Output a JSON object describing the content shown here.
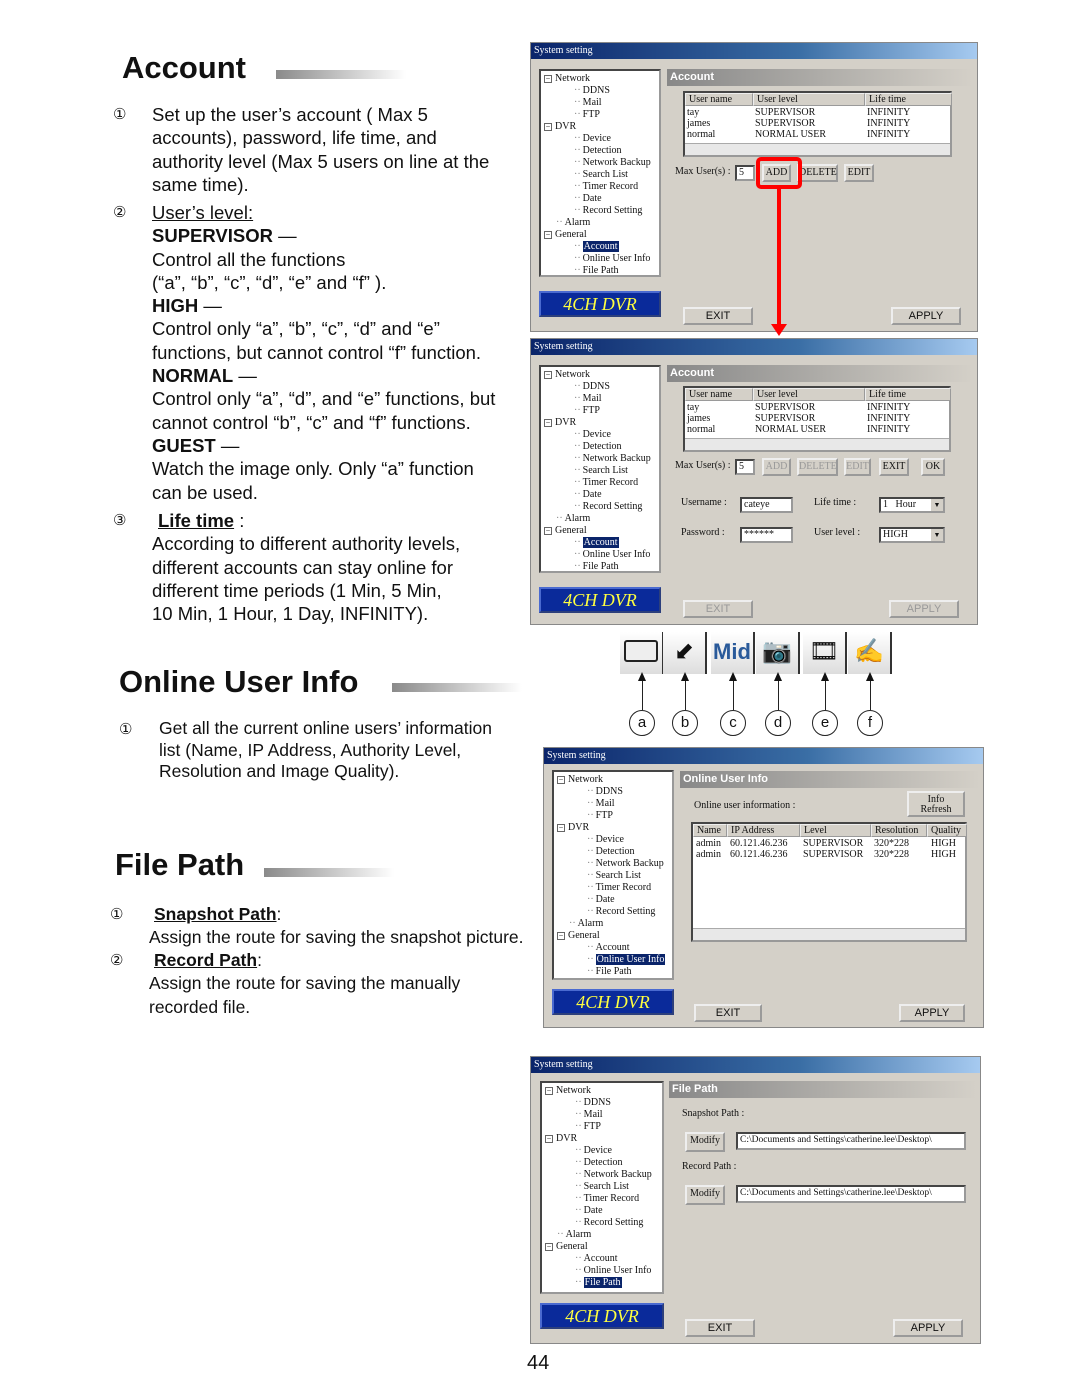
{
  "page_number": "44",
  "account": {
    "heading": "Account",
    "items": [
      {
        "marker": "①",
        "lines": [
          "Set up the user’s account ( Max 5",
          "accounts), password, life time, and",
          "authority level (Max 5 users on line at  the",
          "same time)."
        ]
      },
      {
        "marker": "②",
        "title": "User’s level:"
      }
    ],
    "levels": [
      {
        "name": "SUPERVISOR",
        "dash": "—",
        "lines": [
          "Control all the functions",
          "(“a”, “b”, “c”, “d”, “e” and “f” )."
        ]
      },
      {
        "name": "HIGH",
        "dash": "—",
        "lines": [
          "Control only “a”, “b”, “c”, “d” and “e”",
          "functions, but cannot control “f” function."
        ]
      },
      {
        "name": "NORMAL",
        "dash": "—",
        "lines": [
          "Control only “a”, “d”, and “e” functions, but",
          "cannot control “b”, “c” and “f” functions."
        ]
      },
      {
        "name": "GUEST",
        "dash": "—",
        "lines": [
          "Watch the image only. Only “a” function",
          "can be used."
        ]
      }
    ],
    "lifetime": {
      "marker": "③",
      "title": "Life time",
      "colon": " :",
      "lines": [
        "According to different authority levels,",
        "different accounts can stay online for",
        "different time periods (1 Min, 5 Min,",
        "10 Min, 1 Hour, 1 Day, INFINITY)."
      ]
    }
  },
  "online": {
    "heading": "Online User Info",
    "marker": "①",
    "lines": [
      "Get all the current online users’ information",
      "list (Name, IP Address, Authority Level,",
      "Resolution and Image Quality)."
    ]
  },
  "filepath": {
    "heading": "File Path",
    "items": [
      {
        "marker": "①",
        "title": "Snapshot Path",
        "colon": ":",
        "line": "Assign the route for saving the snapshot picture."
      },
      {
        "marker": "②",
        "title": "Record Path",
        "colon": ":",
        "lines": [
          "Assign the route for saving the manually",
          "recorded file."
        ]
      }
    ]
  },
  "tree": [
    {
      "label": "Network",
      "level": 0,
      "box": "−"
    },
    {
      "label": "DDNS",
      "level": 1
    },
    {
      "label": "Mail",
      "level": 1
    },
    {
      "label": "FTP",
      "level": 1
    },
    {
      "label": "DVR",
      "level": 0,
      "box": "−"
    },
    {
      "label": "Device",
      "level": 1
    },
    {
      "label": "Detection",
      "level": 1
    },
    {
      "label": "Network Backup",
      "level": 1
    },
    {
      "label": "Search List",
      "level": 1
    },
    {
      "label": "Timer Record",
      "level": 1
    },
    {
      "label": "Date",
      "level": 1
    },
    {
      "label": "Record Setting",
      "level": 1
    },
    {
      "label": "Alarm",
      "level": 0
    },
    {
      "label": "General",
      "level": 0,
      "box": "−"
    },
    {
      "label": "Account",
      "level": 1
    },
    {
      "label": "Online User Info",
      "level": 1
    },
    {
      "label": "File Path",
      "level": 1
    }
  ],
  "dialog": {
    "title": "System setting",
    "brand": "4CH DVR",
    "exit": "EXIT",
    "apply": "APPLY"
  },
  "selected": [
    "Account",
    "Account",
    "Online User Info",
    "File Path"
  ],
  "account_panel": {
    "header": "Account",
    "columns": [
      "User name",
      "User level",
      "Life time"
    ],
    "rows": [
      [
        "tay",
        "SUPERVISOR",
        "INFINITY"
      ],
      [
        "james",
        "SUPERVISOR",
        "INFINITY"
      ],
      [
        "normal",
        "NORMAL USER",
        "INFINITY"
      ]
    ],
    "max_label": "Max User(s) :",
    "max_value": "5",
    "add": "ADD",
    "delete": "DELETE",
    "edit": "EDIT",
    "exit": "EXIT",
    "ok": "OK",
    "username_label": "Username :",
    "username_value": "cateye",
    "password_label": "Password :",
    "password_value": "******",
    "lifetime_label": "Life time :",
    "lifetime_value": "1   Hour",
    "userlevel_label": "User level :",
    "userlevel_value": "HIGH",
    "highlight_color": "#ff0000"
  },
  "icons": [
    {
      "icon": "hdd-icon",
      "letter": "a"
    },
    {
      "icon": "minimize-arrow-icon",
      "letter": "b",
      "glyph": "⬋"
    },
    {
      "icon": "quality-mid-icon",
      "letter": "c",
      "glyph": "Mid"
    },
    {
      "icon": "camera-icon",
      "letter": "d",
      "glyph": "📷"
    },
    {
      "icon": "film-icon",
      "letter": "e",
      "glyph": "🎞"
    },
    {
      "icon": "setup-hand-icon",
      "letter": "f",
      "glyph": "✍"
    }
  ],
  "online_panel": {
    "header": "Online User Info",
    "label": "Online user information :",
    "refresh": [
      "Info",
      "Refresh"
    ],
    "columns": [
      "Name",
      "IP Address",
      "Level",
      "Resolution",
      "Quality"
    ],
    "rows": [
      [
        "admin",
        "60.121.46.236",
        "SUPERVISOR",
        "320*228",
        "HIGH"
      ],
      [
        "admin",
        "60.121.46.236",
        "SUPERVISOR",
        "320*228",
        "HIGH"
      ]
    ]
  },
  "file_panel": {
    "header": "File Path",
    "snapshot_label": "Snapshot Path :",
    "record_label": "Record Path :",
    "modify": "Modify",
    "snapshot_value": "C:\\Documents and Settings\\catherine.lee\\Desktop\\",
    "record_value": "C:\\Documents and Settings\\catherine.lee\\Desktop\\"
  }
}
